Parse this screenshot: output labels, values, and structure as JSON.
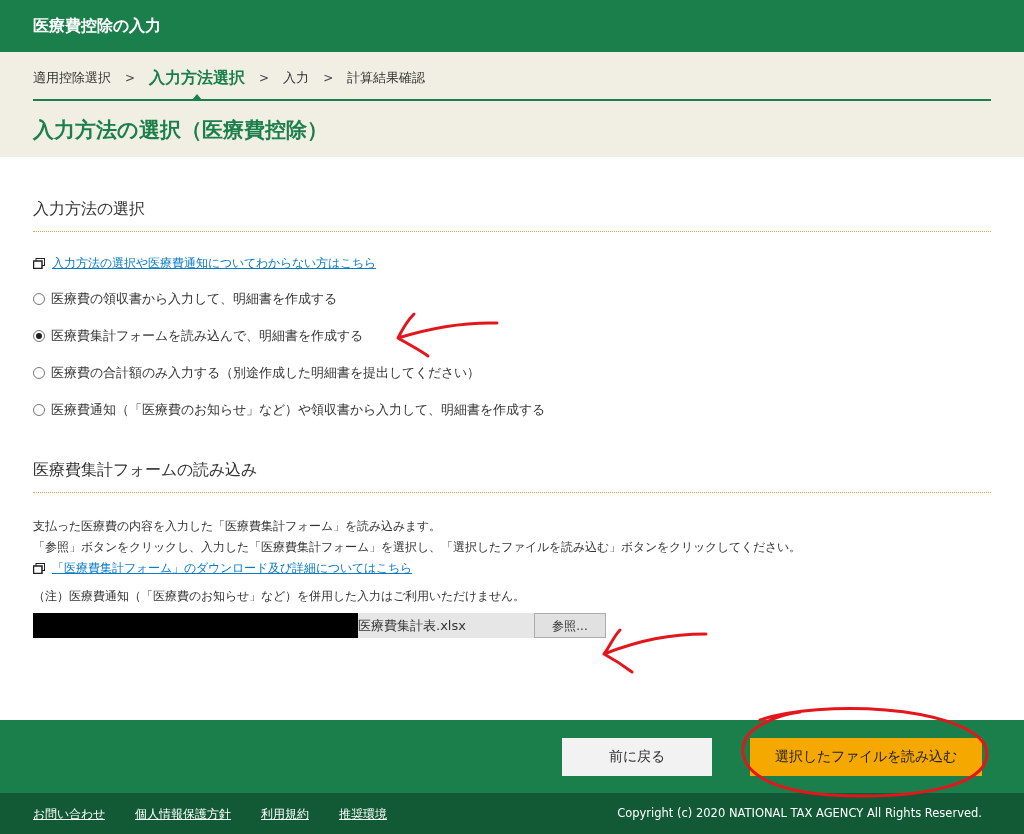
{
  "header": {
    "title": "医療費控除の入力"
  },
  "breadcrumb": [
    {
      "label": "適用控除選択",
      "selected": false
    },
    {
      "label": "入力方法選択",
      "selected": true
    },
    {
      "label": "入力",
      "selected": false
    },
    {
      "label": "計算結果確認",
      "selected": false
    }
  ],
  "breadcrumb_separator": ">",
  "page_title": "入力方法の選択（医療費控除）",
  "methods": {
    "heading": "入力方法の選択",
    "help_link": "入力方法の選択や医療費通知についてわからない方はこちら",
    "options": [
      {
        "label": "医療費の領収書から入力して、明細書を作成する",
        "selected": false
      },
      {
        "label": "医療費集計フォームを読み込んで、明細書を作成する",
        "selected": true
      },
      {
        "label": "医療費の合計額のみ入力する（別途作成した明細書を提出してください）",
        "selected": false
      },
      {
        "label": "医療費通知（「医療費のお知らせ」など）や領収書から入力して、明細書を作成する",
        "selected": false
      }
    ]
  },
  "upload": {
    "heading": "医療費集計フォームの読み込み",
    "paragraphs": [
      "支払った医療費の内容を入力した「医療費集計フォーム」を読み込みます。",
      "「参照」ボタンをクリックし、入力した「医療費集計フォーム」を選択し、「選択したファイルを読み込む」ボタンをクリックしてください。"
    ],
    "download_link": "「医療費集計フォーム」のダウンロード及び詳細についてはこちら",
    "note": "（注）医療費通知（「医療費のお知らせ」など）を併用した入力はご利用いただけません。",
    "file_value": "医療費集計表.xlsx",
    "browse_button": "参照..."
  },
  "actions": {
    "back": "前に戻る",
    "primary": "選択したファイルを読み込む"
  },
  "footer": {
    "links": [
      "お問い合わせ",
      "個人情報保護方針",
      "利用規約",
      "推奨環境"
    ],
    "copyright": "Copyright (c) 2020 NATIONAL TAX AGENCY All Rights Reserved."
  }
}
